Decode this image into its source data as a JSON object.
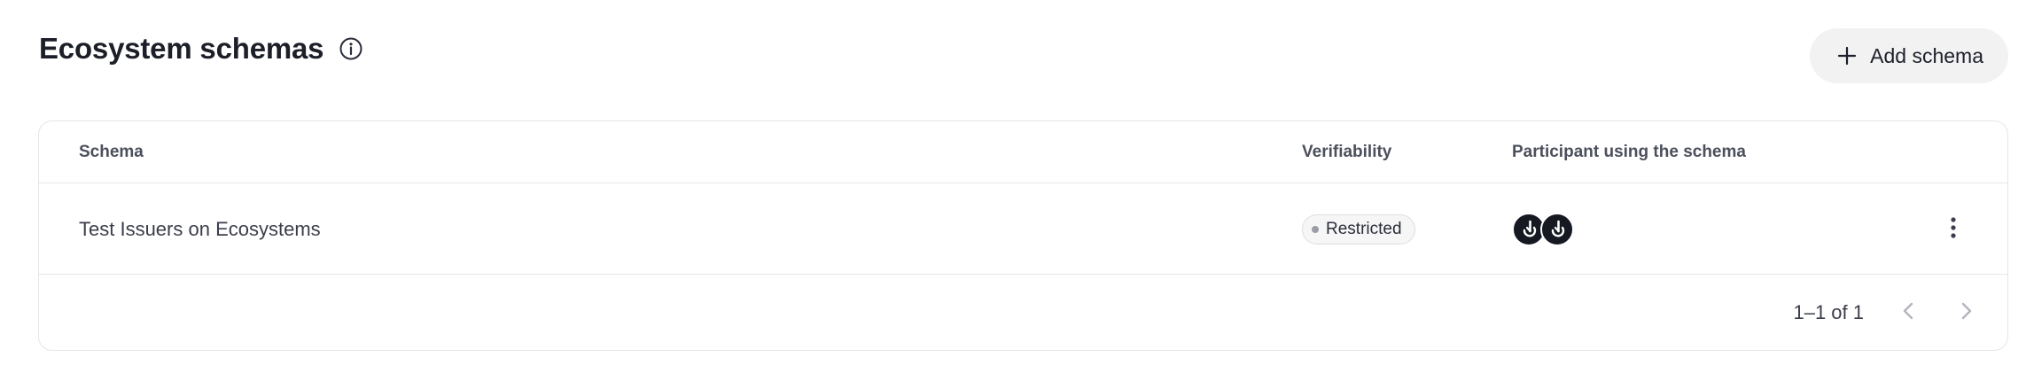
{
  "header": {
    "title": "Ecosystem schemas",
    "info_icon": "info-circle-icon",
    "add_button_label": "Add schema",
    "add_button_icon": "plus-icon"
  },
  "table": {
    "columns": [
      "Schema",
      "Verifiability",
      "Participant using the schema"
    ],
    "rows": [
      {
        "schema": "Test Issuers on Ecosystems",
        "verifiability": "Restricted",
        "participants": [
          "participant-logo-icon",
          "participant-logo-icon"
        ],
        "actions_icon": "more-vertical-icon"
      }
    ]
  },
  "pagination": {
    "range_label": "1–1 of 1",
    "prev_icon": "chevron-left-icon",
    "next_icon": "chevron-right-icon"
  },
  "colors": {
    "background": "#ffffff",
    "border": "#e6e6ea",
    "button_bg": "#f2f2f3",
    "avatar_bg": "#161822",
    "badge_dot": "#9a9ca6"
  }
}
